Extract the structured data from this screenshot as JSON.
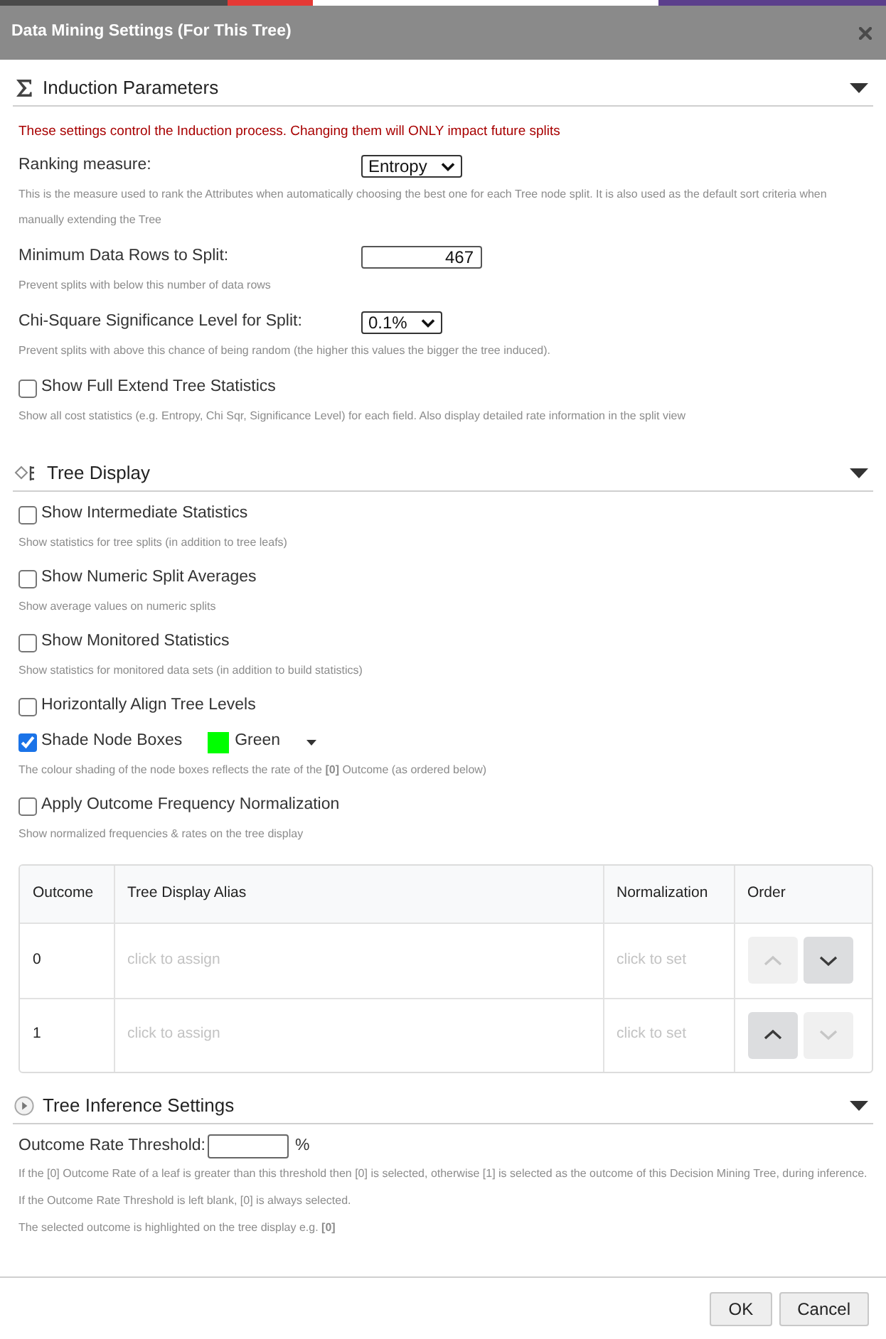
{
  "window": {
    "title": "Data Mining Settings (For This Tree)"
  },
  "sections": [
    {
      "kind": "induction",
      "title": "Induction Parameters",
      "expanded": true,
      "items": [
        {
          "kind": "warning",
          "text": "These settings control the Induction process. Changing them will ONLY impact future splits"
        },
        {
          "kind": "select",
          "label": "Ranking measure:",
          "value": "Entropy",
          "help": "This is the measure used to rank the Attributes when automatically choosing the best one for each Tree node split. It is also used as the default sort criteria when manually extending the Tree"
        },
        {
          "kind": "number",
          "label": "Minimum Data Rows to Split:",
          "value": "467",
          "help": "Prevent splits with below this number of data rows"
        },
        {
          "kind": "select",
          "label": "Chi-Square Significance Level for Split:",
          "value": "0.1%",
          "help": "Prevent splits with above this chance of being random (the higher this values the bigger the tree induced)."
        },
        {
          "kind": "checkbox",
          "label": "Show Full Extend Tree Statistics",
          "checked": false,
          "help": "Show all cost statistics (e.g. Entropy, Chi Sqr, Significance Level) for each field. Also display detailed rate information in the split view"
        }
      ]
    },
    {
      "kind": "display",
      "title": "Tree Display",
      "expanded": true,
      "items": [
        {
          "kind": "checkbox",
          "label": "Show Intermediate Statistics",
          "checked": false,
          "help": "Show statistics for tree splits (in addition to tree leafs)"
        },
        {
          "kind": "checkbox",
          "label": "Show Numeric Split Averages",
          "checked": false,
          "help": "Show average values on numeric splits"
        },
        {
          "kind": "checkbox",
          "label": "Show Monitored Statistics",
          "checked": false,
          "help": "Show statistics for monitored data sets (in addition to build statistics)"
        },
        {
          "kind": "checkbox",
          "label": "Horizontally Align Tree Levels",
          "checked": false
        },
        {
          "kind": "checkbox",
          "label": "Shade Node Boxes",
          "checked": true,
          "color": "#00ff00",
          "color_name": "Green",
          "help": "The colour shading of the node boxes reflects the rate of the **[0]** Outcome (as ordered below)"
        },
        {
          "kind": "checkbox",
          "label": "Apply Outcome Frequency Normalization",
          "checked": false,
          "help": "Show normalized frequencies & rates on the tree display"
        },
        {
          "kind": "table",
          "columns": [
            "Outcome",
            "Tree Display Alias",
            "Normalization",
            "Order"
          ],
          "rows": [
            {
              "outcome": "0",
              "alias_placeholder": "click to assign",
              "normalization_placeholder": "click to set",
              "up_disabled": true,
              "down_disabled": false
            },
            {
              "outcome": "1",
              "alias_placeholder": "click to assign",
              "normalization_placeholder": "click to set",
              "up_disabled": false,
              "down_disabled": true
            }
          ]
        }
      ]
    },
    {
      "kind": "inference",
      "title": "Tree Inference Settings",
      "expanded": true,
      "items": [
        {
          "kind": "threshold",
          "label": "Outcome Rate Threshold:",
          "unit": "%",
          "help": [
            "If the [0] Outcome Rate of a leaf is greater than this threshold then [0] is selected, otherwise [1] is selected as the outcome of this Decision Mining Tree, during inference. If the Outcome Rate Threshold is left blank, [0] is always selected.",
            "The selected outcome is highlighted on the tree display e.g. **[0]**"
          ]
        }
      ]
    }
  ],
  "buttons": [
    "OK",
    "Cancel"
  ]
}
